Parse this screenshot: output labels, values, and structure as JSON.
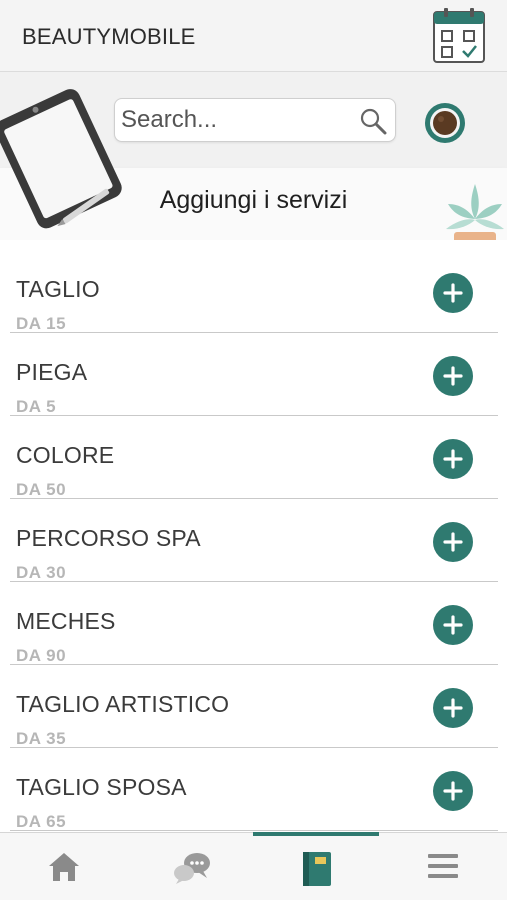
{
  "header": {
    "app_title": "BEAUTYMOBILE",
    "calendar_icon": "calendar-check-icon"
  },
  "search": {
    "placeholder": "Search...",
    "value": ""
  },
  "hero": {
    "section_title": "Aggiungi i servizi",
    "profile_icon": "coffee-cup-icon"
  },
  "colors": {
    "accent": "#2f7a70",
    "price_text": "#b6b6b6",
    "divider": "#c9c9c9"
  },
  "services": [
    {
      "name": "TAGLIO",
      "price": "DA 15"
    },
    {
      "name": "PIEGA",
      "price": "DA 5"
    },
    {
      "name": "COLORE",
      "price": "DA 50"
    },
    {
      "name": "PERCORSO SPA",
      "price": "DA 30"
    },
    {
      "name": "MECHES",
      "price": "DA 90"
    },
    {
      "name": "TAGLIO ARTISTICO",
      "price": "DA 35"
    },
    {
      "name": "TAGLIO SPOSA",
      "price": "DA 65"
    }
  ],
  "tabbar": {
    "tabs": [
      {
        "icon": "home-icon",
        "active": false
      },
      {
        "icon": "chat-bubbles-icon",
        "active": false
      },
      {
        "icon": "notebook-icon",
        "active": true
      },
      {
        "icon": "menu-icon",
        "active": false
      }
    ]
  }
}
